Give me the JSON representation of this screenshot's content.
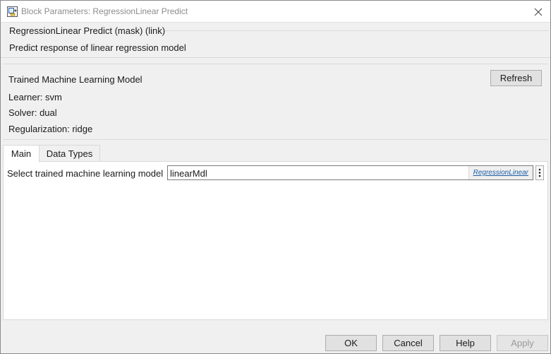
{
  "window": {
    "title": "Block Parameters: RegressionLinear Predict",
    "icon": "simulink-block-icon"
  },
  "mask": {
    "title": "RegressionLinear Predict (mask) (link)",
    "description": "Predict response of linear regression model"
  },
  "model_panel": {
    "title": "Trained Machine Learning Model",
    "refresh_label": "Refresh",
    "learner": "Learner: svm",
    "solver": "Solver: dual",
    "regularization": "Regularization: ridge"
  },
  "tabs": [
    {
      "label": "Main",
      "active": true
    },
    {
      "label": "Data Types",
      "active": false
    }
  ],
  "main": {
    "select_label": "Select trained machine learning model",
    "model_value": "linearMdl",
    "model_link": "RegressionLinear"
  },
  "footer": {
    "ok": "OK",
    "cancel": "Cancel",
    "help": "Help",
    "apply": "Apply",
    "apply_enabled": false
  },
  "colors": {
    "link": "#1f5fa8",
    "dialog_bg": "#f0f0f0",
    "disabled_text": "#9a9a9a"
  }
}
